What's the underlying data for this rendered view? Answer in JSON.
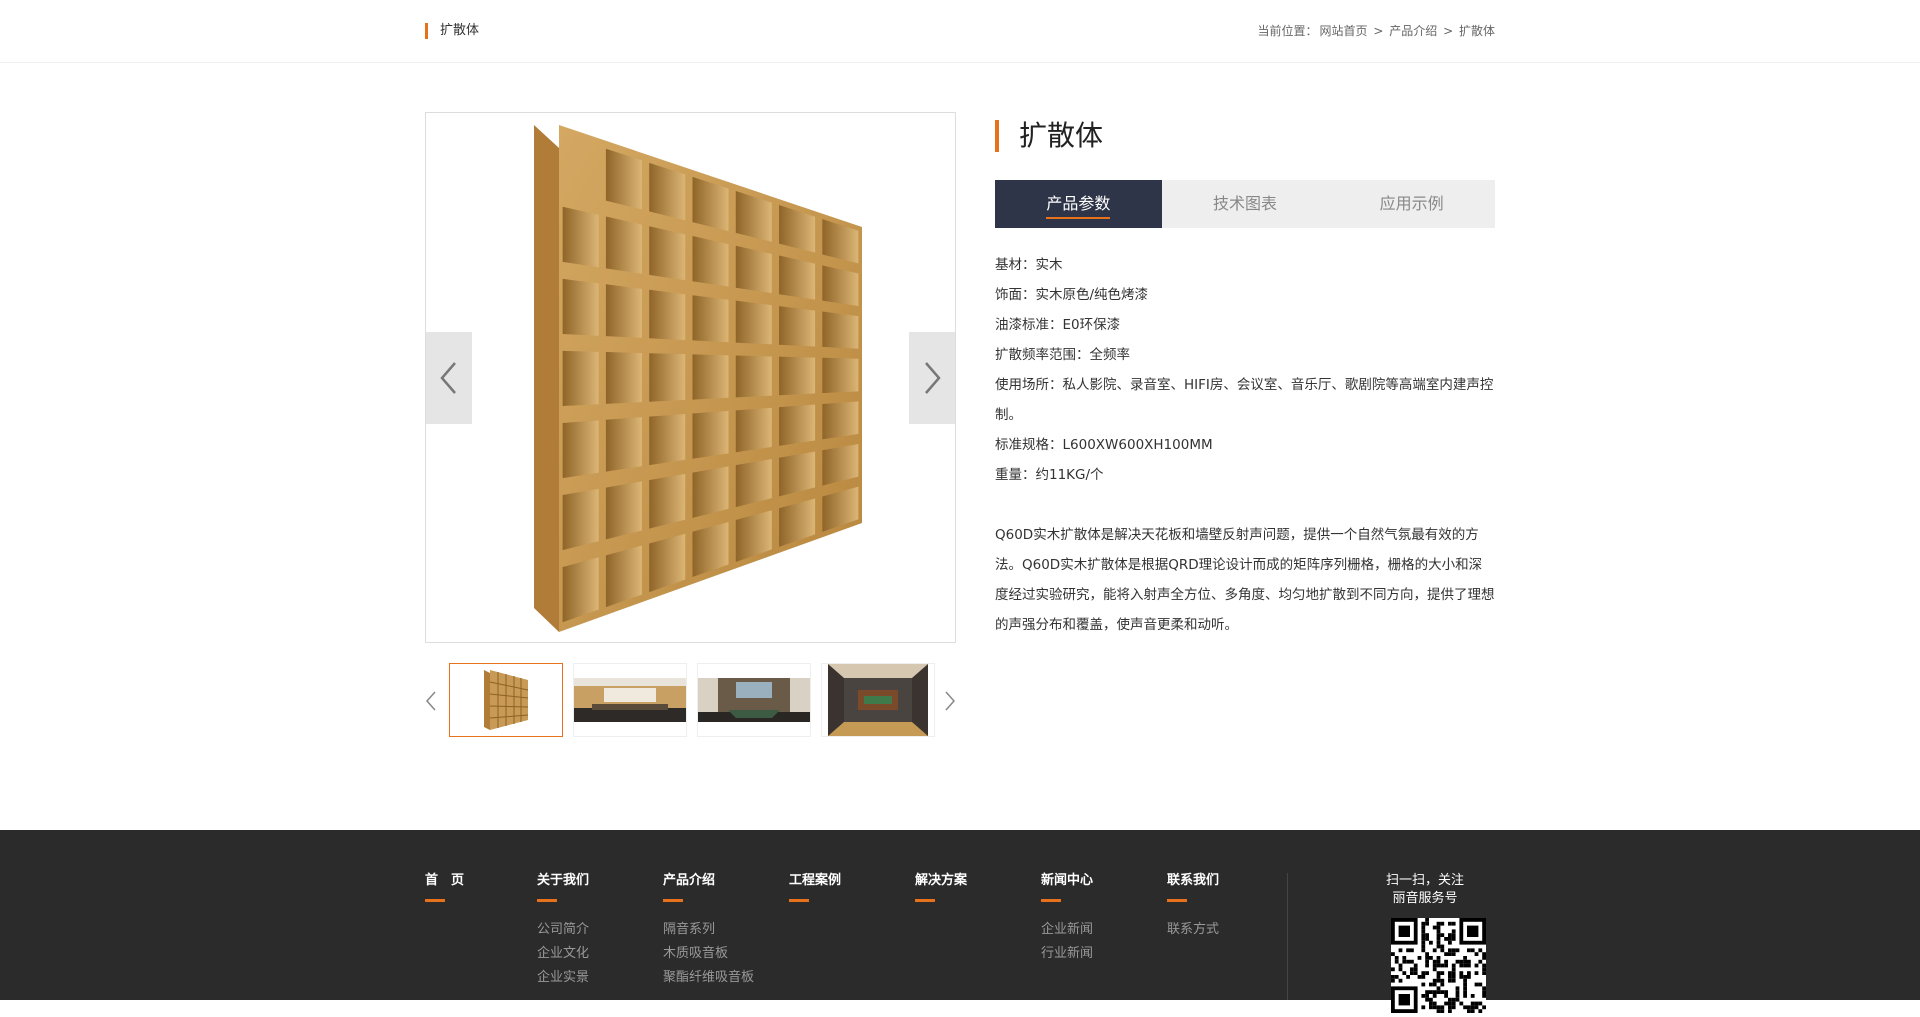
{
  "topbar": {
    "title": "扩散体",
    "crumb_prefix": "当前位置：",
    "crumb": [
      "网站首页",
      "产品介绍",
      "扩散体"
    ],
    "crumb_sep": ">"
  },
  "product": {
    "title": "扩散体",
    "tabs": [
      "产品参数",
      "技术图表",
      "应用示例"
    ],
    "params": [
      "基材：实木",
      "饰面：实木原色/纯色烤漆",
      "油漆标准：E0环保漆",
      "扩散频率范围：全频率",
      "使用场所：私人影院、录音室、HIFI房、会议室、音乐厅、歌剧院等高端室内建声控制。",
      "标准规格：L600XW600XH100MM",
      "重量：约11KG/个"
    ],
    "description": "Q60D实木扩散体是解决天花板和墙壁反射声问题，提供一个自然气氛最有效的方法。Q60D实木扩散体是根据QRD理论设计而成的矩阵序列栅格，栅格的大小和深度经过实验研究，能将入射声全方位、多角度、均匀地扩散到不同方向，提供了理想的声强分布和覆盖，使声音更柔和动听。"
  },
  "gallery": {
    "main_image": "diffuser-product-image",
    "thumbs": [
      "diffuser-thumb",
      "meeting-room-thumb",
      "conference-room-thumb",
      "top-view-room-thumb"
    ]
  },
  "footer": {
    "cols": [
      {
        "head": "首　页",
        "links": []
      },
      {
        "head": "关于我们",
        "links": [
          "公司简介",
          "企业文化",
          "企业实景"
        ]
      },
      {
        "head": "产品介绍",
        "links": [
          "隔音系列",
          "木质吸音板",
          "聚酯纤维吸音板"
        ]
      },
      {
        "head": "工程案例",
        "links": []
      },
      {
        "head": "解决方案",
        "links": []
      },
      {
        "head": "新闻中心",
        "links": [
          "企业新闻",
          "行业新闻"
        ]
      },
      {
        "head": "联系我们",
        "links": [
          "联系方式"
        ]
      }
    ],
    "qr_title": "扫一扫，关注\n丽音服务号"
  },
  "colors": {
    "accent": "#e8711c",
    "tab_active": "#2f3548",
    "footer_bg": "#2b2b2b"
  }
}
